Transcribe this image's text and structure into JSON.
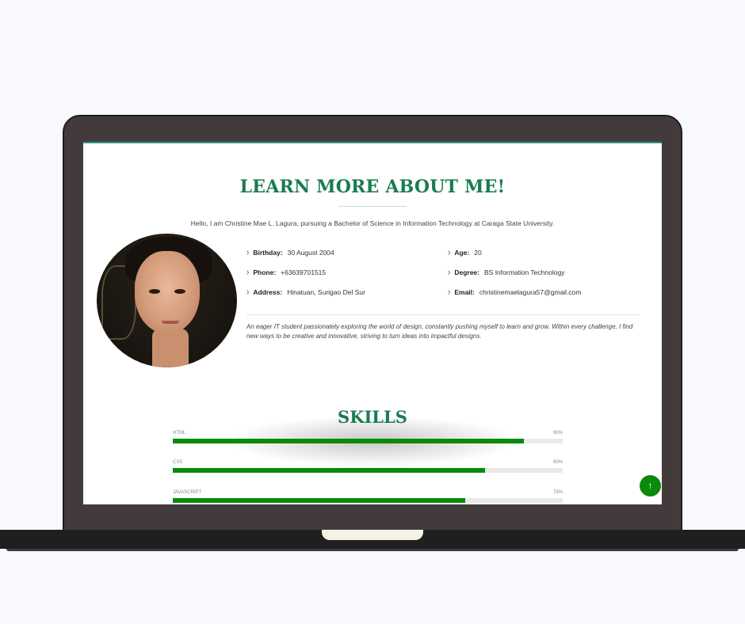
{
  "about": {
    "title": "LEARN MORE ABOUT ME!",
    "intro": "Hello, I am Christine Mae L. Lagura, pursuing a Bachelor of Science in Information Technology at Caraga State University.",
    "info": [
      {
        "label": "Birthday:",
        "value": "30 August 2004"
      },
      {
        "label": "Age:",
        "value": "20"
      },
      {
        "label": "Phone:",
        "value": "+63639701515"
      },
      {
        "label": "Degree:",
        "value": "BS Information Technology"
      },
      {
        "label": "Address:",
        "value": "Hinatuan, Surigao Del Sur"
      },
      {
        "label": "Email:",
        "value": "christinemaelagura57@gmail.com"
      }
    ],
    "bio": "An eager IT student passionately exploring the world of design, constantly pushing myself to learn and grow. Within every challenge, I find new ways to be creative and innovative, striving to turn ideas into impactful designs."
  },
  "skills": {
    "title": "SKILLS",
    "items": [
      {
        "name": "HTML",
        "percent_label": "90%",
        "percent": 90
      },
      {
        "name": "CSS",
        "percent_label": "80%",
        "percent": 80
      },
      {
        "name": "JAVASCRIPT",
        "percent_label": "75%",
        "percent": 75
      }
    ]
  },
  "icons": {
    "chevron": "chevron-right-icon",
    "back_to_top": "arrow-up-icon"
  },
  "colors": {
    "accent": "#197c50",
    "progress": "#0a8a0a",
    "bezel": "#433b3b"
  }
}
